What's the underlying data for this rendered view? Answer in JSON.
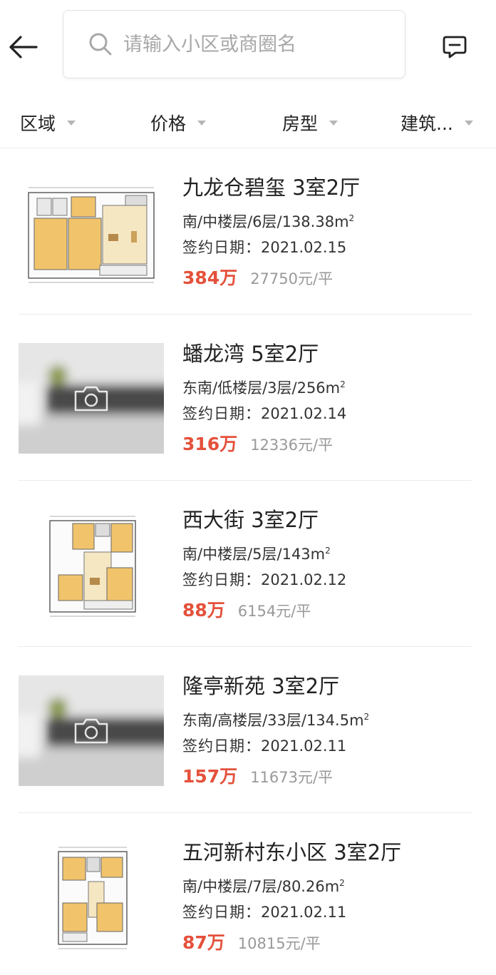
{
  "search": {
    "placeholder": "请输入小区或商圈名"
  },
  "filters": [
    {
      "label": "区域"
    },
    {
      "label": "价格"
    },
    {
      "label": "房型"
    },
    {
      "label": "建筑..."
    }
  ],
  "listings": [
    {
      "title": "九龙仓碧玺 3室2厅",
      "meta": "南/中楼层/6层/138.38m",
      "area_unit_sup": "2",
      "date_label": "签约日期：",
      "date": "2021.02.15",
      "price": "384万",
      "unit_price": "27750元/平",
      "thumb": "floorplan"
    },
    {
      "title": "蟠龙湾 5室2厅",
      "meta": "东南/低楼层/3层/256m",
      "area_unit_sup": "2",
      "date_label": "签约日期：",
      "date": "2021.02.14",
      "price": "316万",
      "unit_price": "12336元/平",
      "thumb": "blurred-photo"
    },
    {
      "title": "西大街 3室2厅",
      "meta": "南/中楼层/5层/143m",
      "area_unit_sup": "2",
      "date_label": "签约日期：",
      "date": "2021.02.12",
      "price": "88万",
      "unit_price": "6154元/平",
      "thumb": "floorplan"
    },
    {
      "title": "隆亭新苑 3室2厅",
      "meta": "东南/高楼层/33层/134.5m",
      "area_unit_sup": "2",
      "date_label": "签约日期：",
      "date": "2021.02.11",
      "price": "157万",
      "unit_price": "11673元/平",
      "thumb": "blurred-photo"
    },
    {
      "title": "五河新村东小区 3室2厅",
      "meta": "南/中楼层/7层/80.26m",
      "area_unit_sup": "2",
      "date_label": "签约日期：",
      "date": "2021.02.11",
      "price": "87万",
      "unit_price": "10815元/平",
      "thumb": "floorplan"
    }
  ],
  "icons": {
    "back": "back-arrow-icon",
    "search": "search-icon",
    "message": "message-icon",
    "dropdown": "caret-down-icon",
    "camera": "camera-icon"
  },
  "colors": {
    "price": "#e4513b",
    "unit_price": "#999999",
    "divider": "#ececec",
    "filter_arrow": "#b5b5b5"
  }
}
